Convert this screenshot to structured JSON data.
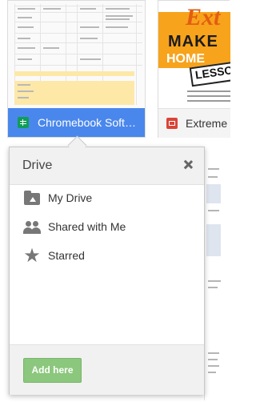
{
  "tiles": [
    {
      "title": "Chromebook Softwa...",
      "icon": "google-sheets-icon"
    },
    {
      "title": "Extreme",
      "icon": "google-slides-icon",
      "thumb_words": [
        "Ext",
        "MAKE",
        "HOME",
        "LESSON"
      ]
    }
  ],
  "popup": {
    "title": "Drive",
    "nav": [
      {
        "label": "My Drive",
        "icon": "drive-folder-icon"
      },
      {
        "label": "Shared with Me",
        "icon": "people-icon"
      },
      {
        "label": "Starred",
        "icon": "star-icon"
      }
    ],
    "add_button": "Add here"
  },
  "colors": {
    "sheets_footer": "#4a87ec",
    "add_button": "#8bc77c"
  }
}
